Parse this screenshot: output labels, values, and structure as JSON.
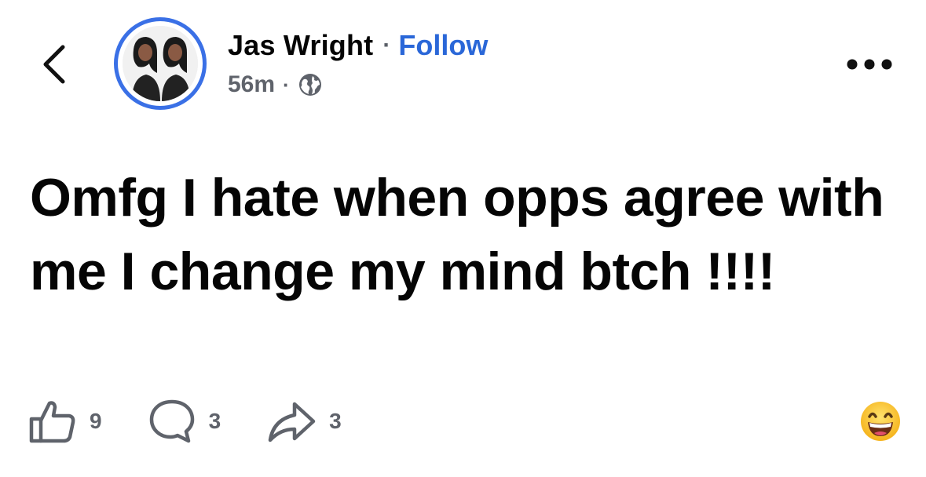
{
  "header": {
    "back_icon": "chevron-left-icon",
    "author_name": "Jas Wright",
    "separator": "·",
    "follow_label": "Follow",
    "time": "56m",
    "meta_separator": "·",
    "privacy_icon": "globe-icon",
    "more_icon": "more-horizontal-icon"
  },
  "post": {
    "text": "Omfg I hate when opps agree with me I change my mind btch !!!!"
  },
  "actions": {
    "like": {
      "icon": "thumbs-up-icon",
      "count": "9"
    },
    "comment": {
      "icon": "comment-bubble-icon",
      "count": "3"
    },
    "share": {
      "icon": "share-arrow-icon",
      "count": "3"
    },
    "reaction_icon": "grinning-face-emoji-icon"
  },
  "colors": {
    "accent": "#2a67d8",
    "avatar_ring": "#3a70e6",
    "text_primary": "#050505",
    "text_secondary": "#5f636b"
  }
}
